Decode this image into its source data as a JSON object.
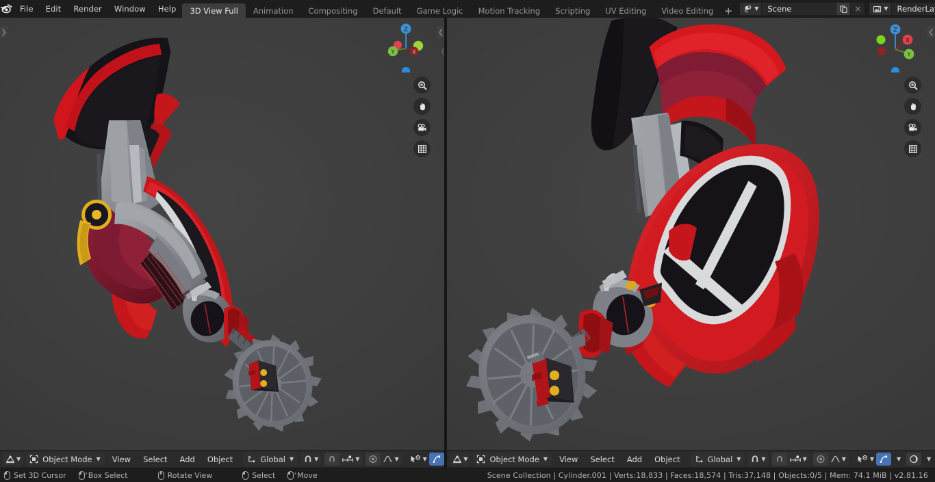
{
  "app": {
    "logo_icon": "blender-logo",
    "version": "v2.81.16"
  },
  "menu": {
    "items": [
      {
        "label": "File"
      },
      {
        "label": "Edit"
      },
      {
        "label": "Render"
      },
      {
        "label": "Window"
      },
      {
        "label": "Help"
      }
    ]
  },
  "workspace_tabs": {
    "items": [
      {
        "label": "3D View Full",
        "active": true
      },
      {
        "label": "Animation",
        "active": false
      },
      {
        "label": "Compositing",
        "active": false
      },
      {
        "label": "Default",
        "active": false
      },
      {
        "label": "Game Logic",
        "active": false
      },
      {
        "label": "Motion Tracking",
        "active": false
      },
      {
        "label": "Scripting",
        "active": false
      },
      {
        "label": "UV Editing",
        "active": false
      },
      {
        "label": "Video Editing",
        "active": false
      }
    ],
    "add_label": "+"
  },
  "scene_selector": {
    "icon": "scene-icon",
    "name": "Scene",
    "duplicate_icon": "copy-icon",
    "close_label": "×"
  },
  "viewlayer_selector": {
    "icon": "render-layers-icon",
    "name": "RenderLayer",
    "duplicate_icon": "copy-icon",
    "close_label": "×"
  },
  "viewports": [
    {
      "id": "left",
      "gizmo": {
        "axes": [
          {
            "label": "Z",
            "color": "#3e8fd4",
            "filled": true
          },
          {
            "label": "Y",
            "color": "#7bc043",
            "filled": true
          },
          {
            "label": "X",
            "color": "#cc3344",
            "filled": true
          }
        ],
        "nav_buttons": [
          {
            "icon": "zoom-icon"
          },
          {
            "icon": "hand-pan-icon"
          },
          {
            "icon": "camera-icon"
          },
          {
            "icon": "grid-ortho-icon"
          }
        ]
      },
      "footer": {
        "editor_type_icon": "editor-type-3dview-icon",
        "mode": "Object Mode",
        "mode_icon": "object-mode-icon",
        "menus": [
          "View",
          "Select",
          "Add",
          "Object"
        ],
        "transform_orientation": "Global",
        "transform_orientation_icon": "orientation-icon",
        "snap_icon": "magnet-icon",
        "snap_target_icon": "snap-increment-icon",
        "proportional_icon": "proportional-editing-icon",
        "proportional_falloff_icon": "smooth-falloff-icon",
        "pivot_icon": "pivot-icon",
        "visibility_icon": "show-gizmo-icon",
        "gizmo_icon": "gizmo-icon",
        "gizmo_active": true
      }
    },
    {
      "id": "right",
      "gizmo": {
        "axes": [
          {
            "label": "Z",
            "color": "#3e8fd4",
            "filled": true
          },
          {
            "label": "X",
            "color": "#e0414f",
            "filled": true
          },
          {
            "label": "Y",
            "color": "#7bc043",
            "filled": true
          }
        ],
        "nav_buttons": [
          {
            "icon": "zoom-icon"
          },
          {
            "icon": "hand-pan-icon"
          },
          {
            "icon": "camera-icon"
          },
          {
            "icon": "grid-ortho-icon"
          }
        ]
      },
      "footer": {
        "editor_type_icon": "editor-type-3dview-icon",
        "mode": "Object Mode",
        "mode_icon": "object-mode-icon",
        "menus": [
          "View",
          "Select",
          "Add",
          "Object"
        ],
        "transform_orientation": "Global",
        "transform_orientation_icon": "orientation-icon",
        "snap_icon": "magnet-icon",
        "snap_target_icon": "snap-increment-icon",
        "proportional_icon": "proportional-editing-icon",
        "proportional_falloff_icon": "smooth-falloff-icon",
        "pivot_icon": "pivot-icon",
        "visibility_icon": "show-gizmo-icon",
        "gizmo_icon": "gizmo-icon",
        "gizmo_active": true,
        "shading_icon": "shading-solid-icon"
      }
    }
  ],
  "statusbar": {
    "keymap": [
      {
        "mouse": "left",
        "label": "Set 3D Cursor"
      },
      {
        "mouse": "middle",
        "label": "Box Select"
      },
      {
        "mouse": "middle",
        "label": "Rotate View"
      },
      {
        "mouse": "left",
        "label": "Select"
      },
      {
        "mouse": "middle",
        "label": "Move"
      }
    ],
    "stats": "Scene Collection | Cylinder.001 | Verts:18,833 | Faces:18,574 | Tris:37,148 | Objects:0/5 | Mem: 74.1 MiB | v2.81.16"
  },
  "colors": {
    "accent_blue": "#4772b3",
    "viewport_bg": "#3b3b3b",
    "header_bg": "#2b2b2b",
    "window_bg": "#1d1d1d",
    "model_red": "#cc1f21",
    "model_darkred": "#7b1226",
    "model_grey": "#8d9095",
    "model_black": "#17151a",
    "model_yellow": "#e0ae1f"
  }
}
